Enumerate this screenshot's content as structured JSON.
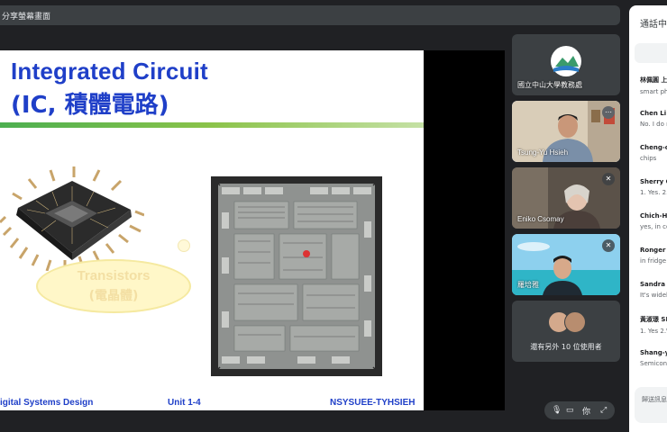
{
  "topbar": {
    "label": "分享螢幕畫面"
  },
  "slide": {
    "title_line1": "Integrated Circuit",
    "title_line2": "(IC, 積體電路)",
    "bubble_line1": "Transistors",
    "bubble_line2": "(電晶體)",
    "footer_left": "igital Systems Design",
    "footer_center": "Unit 1-4",
    "footer_right": "NSYSUEE-TYHSIEH"
  },
  "participants": [
    {
      "name": "國立中山大學教務處",
      "type": "logo"
    },
    {
      "name": "Tsung-Yu Hsieh",
      "type": "video"
    },
    {
      "name": "Eniko Csomay",
      "type": "video"
    },
    {
      "name": "羅培雅",
      "type": "video"
    }
  ],
  "others": {
    "label": "還有另外 10 位使用者"
  },
  "chat": {
    "title": "通話中",
    "messages": [
      {
        "who": "林佩圓 上",
        "txt": "smart phe"
      },
      {
        "who": "Chen Li H",
        "txt": "No. I do n"
      },
      {
        "who": "Cheng-ch",
        "txt": "chips"
      },
      {
        "who": "Sherry Ou",
        "txt": "1. Yes. 2."
      },
      {
        "who": "Chich-Hs",
        "txt": "yes, in co"
      },
      {
        "who": "Ronger H",
        "txt": "in fridge"
      },
      {
        "who": "Sandra Y",
        "txt": "It's widely"
      },
      {
        "who": "黃淑璟 SH",
        "txt": "1. Yes 2.\\"
      },
      {
        "who": "Shang-yu",
        "txt": "Semicond"
      }
    ],
    "input_placeholder": "歸送訊息"
  },
  "controls": {
    "you_label": "你"
  },
  "colors": {
    "slide_title": "#1f3fc8",
    "background": "#202124"
  }
}
